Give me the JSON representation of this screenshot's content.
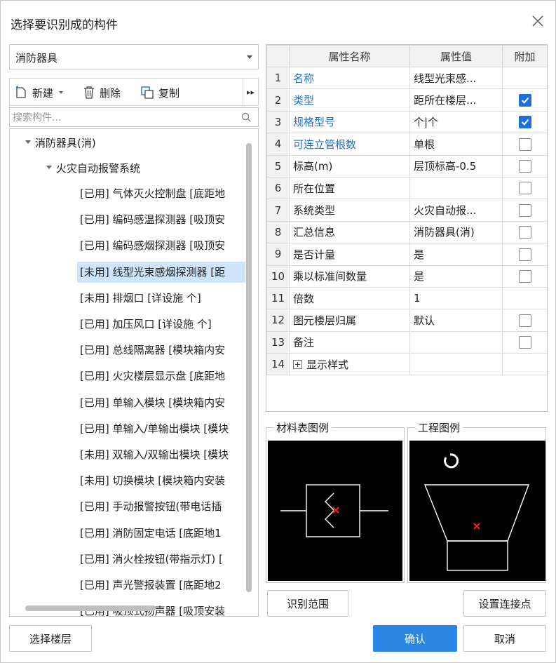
{
  "dialog": {
    "title": "选择要识别成的构件"
  },
  "component_select": {
    "value": "消防器具"
  },
  "toolbar": {
    "new_label": "新建",
    "delete_label": "删除",
    "copy_label": "复制"
  },
  "search": {
    "placeholder": "搜索构件..."
  },
  "tree": {
    "root": "消防器具(消)",
    "group": "火灾自动报警系统",
    "items": [
      "[已用] 气体灭火控制盘 [底距地",
      "[已用] 编码感温探测器 [吸顶安",
      "[已用] 编码感烟探测器 [吸顶安",
      "[未用] 线型光束感烟探测器 [距",
      "[未用] 排烟口 [详设施 个]",
      "[已用] 加压风口 [详设施 个]",
      "[已用] 总线隔离器 [模块箱内安",
      "[已用] 火灾楼层显示盘 [底距地",
      "[已用] 单输入模块 [模块箱内安",
      "[已用] 单输入/单输出模块 [模块",
      "[未用] 双输入/双输出模块 [模块",
      "[未用] 切换模块 [模块箱内安装",
      "[已用] 手动报警按钮(带电话插",
      "[已用] 消防固定电话 [底距地1",
      "[已用] 消火栓按钮(带指示灯) [",
      "[已用] 声光警报装置 [底距地2",
      "[已用] 吸顶式扬声器 [吸顶安装"
    ]
  },
  "properties": {
    "headers": [
      "属性名称",
      "属性值",
      "附加"
    ],
    "rows": [
      {
        "num": "1",
        "name": "名称",
        "value": "线型光束感...",
        "blue": true,
        "check": null
      },
      {
        "num": "2",
        "name": "类型",
        "value": "距所在楼层...",
        "blue": true,
        "check": true
      },
      {
        "num": "3",
        "name": "规格型号",
        "value": "个|个",
        "blue": true,
        "check": true
      },
      {
        "num": "4",
        "name": "可连立管根数",
        "value": "单根",
        "blue": true,
        "check": false
      },
      {
        "num": "5",
        "name": "标高(m)",
        "value": "层顶标高-0.5",
        "blue": false,
        "check": false
      },
      {
        "num": "6",
        "name": "所在位置",
        "value": "",
        "blue": false,
        "check": false
      },
      {
        "num": "7",
        "name": "系统类型",
        "value": "火灾自动报...",
        "blue": false,
        "check": false
      },
      {
        "num": "8",
        "name": "汇总信息",
        "value": "消防器具(消)",
        "blue": false,
        "check": false
      },
      {
        "num": "9",
        "name": "是否计量",
        "value": "是",
        "blue": false,
        "check": false
      },
      {
        "num": "10",
        "name": "乘以标准间数量",
        "value": "是",
        "blue": false,
        "check": false
      },
      {
        "num": "11",
        "name": "倍数",
        "value": "1",
        "blue": false,
        "check": null
      },
      {
        "num": "12",
        "name": "图元楼层归属",
        "value": "默认",
        "blue": false,
        "check": false
      },
      {
        "num": "13",
        "name": "备注",
        "value": "",
        "blue": false,
        "check": false
      },
      {
        "num": "14",
        "name": "显示样式",
        "value": "",
        "blue": false,
        "check": null,
        "expand": "+"
      }
    ]
  },
  "legend": {
    "material_title": "材料表图例",
    "project_title": "工程图例"
  },
  "buttons": {
    "recognize_range": "识别范围",
    "set_connection": "设置连接点",
    "select_floor": "选择楼层",
    "confirm": "确认",
    "cancel": "取消"
  },
  "colors": {
    "accent": "#2b87e3",
    "link_blue": "#1e6fd9",
    "selected_row": "#cde4fb",
    "marker_red": "#ff2020"
  }
}
